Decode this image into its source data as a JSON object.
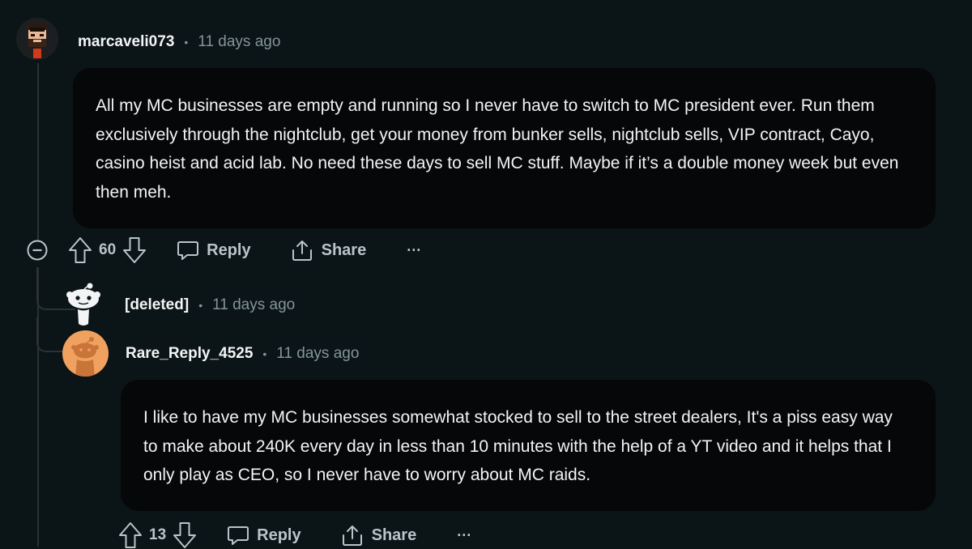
{
  "comment": {
    "username": "marcaveli073",
    "separator": "•",
    "time": "11 days ago",
    "body": "All my MC businesses are empty and running so I never have to switch to MC president ever. Run them exclusively through the nightclub, get your money from bunker sells, nightclub sells, VIP contract, Cayo, casino heist and acid lab. No need these days to sell MC stuff. Maybe if it’s a double money week but even then meh.",
    "score": "60",
    "reply_label": "Reply",
    "share_label": "Share",
    "more_label": "···",
    "collapse_icon": "collapse-thread-icon"
  },
  "deleted_reply": {
    "username": "[deleted]",
    "separator": "•",
    "time": "11 days ago",
    "avatar_icon": "snoo-icon"
  },
  "reply": {
    "username": "Rare_Reply_4525",
    "separator": "•",
    "time": "11 days ago",
    "body": "I like to have my MC businesses somewhat stocked to sell to the street dealers, It's a piss easy way to make about 240K every day in less than 10 minutes with the help of a YT video and it helps that I only play as CEO, so I never have to worry about MC raids.",
    "score": "13",
    "reply_label": "Reply",
    "share_label": "Share",
    "more_label": "···",
    "avatar_color": "#f0a15f"
  },
  "colors": {
    "background": "#0b1416",
    "bubble": "#050708",
    "muted": "#82959b",
    "thread_line": "#2a3236"
  }
}
